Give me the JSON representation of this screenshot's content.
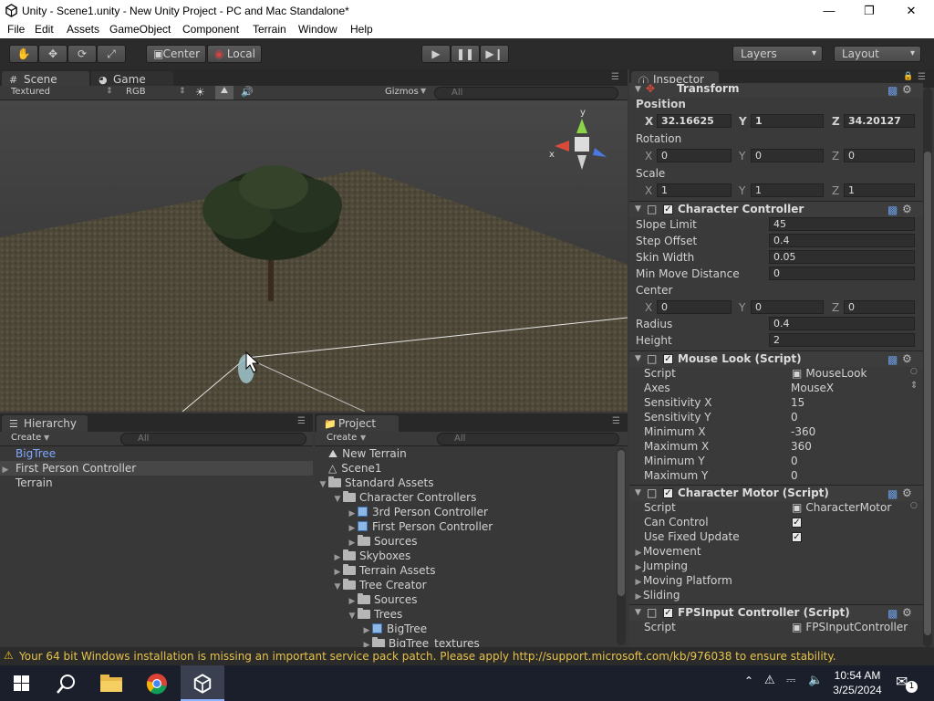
{
  "window": {
    "title": "Unity - Scene1.unity - New Unity Project - PC and Mac Standalone*",
    "minimize": "—",
    "maximize": "❐",
    "close": "✕"
  },
  "menu": [
    "File",
    "Edit",
    "Assets",
    "GameObject",
    "Component",
    "Terrain",
    "Window",
    "Help"
  ],
  "toolbar": {
    "center": "Center",
    "local": "Local",
    "layers": "Layers",
    "layout": "Layout"
  },
  "scene": {
    "tab_scene": "Scene",
    "tab_game": "Game",
    "shading": "Textured",
    "render_mode": "RGB",
    "gizmos": "Gizmos",
    "search": "All",
    "axis_y": "y",
    "axis_x": "x"
  },
  "hierarchy": {
    "title": "Hierarchy",
    "create": "Create",
    "search": "All",
    "items": [
      {
        "label": "BigTree",
        "selected": true
      },
      {
        "label": "First Person Controller",
        "expandable": true
      },
      {
        "label": "Terrain"
      }
    ]
  },
  "project": {
    "title": "Project",
    "create": "Create",
    "search": "All",
    "items": [
      {
        "label": "New Terrain",
        "indent": 0,
        "icon": "terrain-icon"
      },
      {
        "label": "Scene1",
        "indent": 0,
        "icon": "unity-scene-icon"
      },
      {
        "label": "Standard Assets",
        "indent": 0,
        "icon": "folder-icon",
        "open": true
      },
      {
        "label": "Character Controllers",
        "indent": 1,
        "icon": "folder-icon",
        "open": true
      },
      {
        "label": "3rd Person Controller",
        "indent": 2,
        "icon": "prefab-icon",
        "closed": true
      },
      {
        "label": "First Person Controller",
        "indent": 2,
        "icon": "prefab-icon",
        "closed": true
      },
      {
        "label": "Sources",
        "indent": 2,
        "icon": "folder-icon",
        "closed": true
      },
      {
        "label": "Skyboxes",
        "indent": 1,
        "icon": "folder-icon",
        "closed": true
      },
      {
        "label": "Terrain Assets",
        "indent": 1,
        "icon": "folder-icon",
        "closed": true
      },
      {
        "label": "Tree Creator",
        "indent": 1,
        "icon": "folder-icon",
        "open": true
      },
      {
        "label": "Sources",
        "indent": 2,
        "icon": "folder-icon",
        "closed": true
      },
      {
        "label": "Trees",
        "indent": 2,
        "icon": "folder-icon",
        "open": true
      },
      {
        "label": "BigTree",
        "indent": 3,
        "icon": "prefab-icon",
        "closed": true
      },
      {
        "label": "BigTree_textures",
        "indent": 3,
        "icon": "folder-icon",
        "closed": true
      }
    ]
  },
  "inspector": {
    "title": "Inspector",
    "transform": {
      "title": "Transform",
      "position": "Position",
      "rotation": "Rotation",
      "scale": "Scale",
      "px": "32.16625",
      "py": "1",
      "pz": "34.20127",
      "rx": "0",
      "ry": "0",
      "rz": "0",
      "sx": "1",
      "sy": "1",
      "sz": "1",
      "X": "X",
      "Y": "Y",
      "Z": "Z"
    },
    "cc": {
      "title": "Character Controller",
      "slope_label": "Slope Limit",
      "slope": "45",
      "step_label": "Step Offset",
      "step": "0.4",
      "skin_label": "Skin Width",
      "skin": "0.05",
      "minmove_label": "Min Move Distance",
      "minmove": "0",
      "center_label": "Center",
      "cx": "0",
      "cy": "0",
      "cz": "0",
      "radius_label": "Radius",
      "radius": "0.4",
      "height_label": "Height",
      "height": "2"
    },
    "mouselook": {
      "title": "Mouse Look (Script)",
      "script_label": "Script",
      "script": "MouseLook",
      "axes_label": "Axes",
      "axes": "MouseX",
      "sensx_label": "Sensitivity X",
      "sensx": "15",
      "sensy_label": "Sensitivity Y",
      "sensy": "0",
      "minx_label": "Minimum X",
      "minx": "-360",
      "maxx_label": "Maximum X",
      "maxx": "360",
      "miny_label": "Minimum Y",
      "miny": "0",
      "maxy_label": "Maximum Y",
      "maxy": "0"
    },
    "motor": {
      "title": "Character Motor (Script)",
      "script_label": "Script",
      "script": "CharacterMotor",
      "can_control": "Can Control",
      "fixed_update": "Use Fixed Update",
      "movement": "Movement",
      "jumping": "Jumping",
      "moving_platform": "Moving Platform",
      "sliding": "Sliding"
    },
    "fps": {
      "title": "FPSInput Controller (Script)",
      "script_label": "Script",
      "script": "FPSInputController"
    }
  },
  "status": {
    "message": "Your 64 bit Windows installation is missing an important service pack patch. Please apply http://support.microsoft.com/kb/976038 to ensure stability."
  },
  "taskbar": {
    "time": "10:54 AM",
    "date": "3/25/2024",
    "notifications": "1"
  }
}
